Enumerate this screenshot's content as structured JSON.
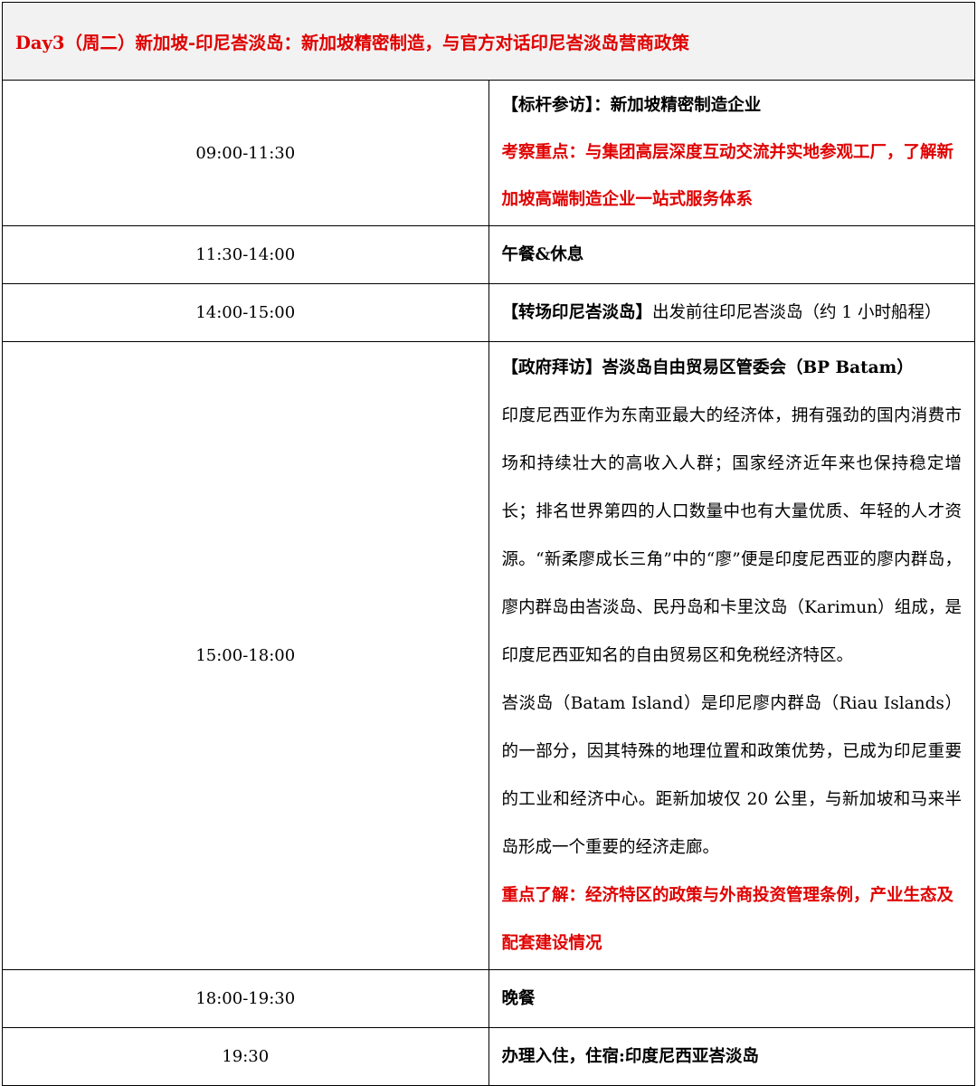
{
  "header": {
    "title": "Day3（周二）新加坡-印尼峇淡岛：新加坡精密制造，与官方对话印尼峇淡岛营商政策"
  },
  "rows": [
    {
      "time": "09:00-11:30",
      "heading_tag": "【标杆参访】",
      "heading_text": "：新加坡精密制造企业",
      "focus": "考察重点：与集团高层深度互动交流并实地参观工厂，了解新加坡高端制造企业一站式服务体系"
    },
    {
      "time": "11:30-14:00",
      "text": "午餐&休息"
    },
    {
      "time": "14:00-15:00",
      "heading_tag": "【转场印尼峇淡岛】",
      "text": "出发前往印尼峇淡岛（约 1 小时船程）"
    },
    {
      "time": "15:00-18:00",
      "heading_tag": "【政府拜访】",
      "heading_text": "峇淡岛自由贸易区管委会（BP Batam）",
      "para1": "印度尼西亚作为东南亚最大的经济体，拥有强劲的国内消费市场和持续壮大的高收入人群；国家经济近年来也保持稳定增长；排名世界第四的人口数量中也有大量优质、年轻的人才资源。“新柔廖成长三角”中的“廖”便是印度尼西亚的廖内群岛，廖内群岛由峇淡岛、民丹岛和卡里汶岛（Karimun）组成，是印度尼西亚知名的自由贸易区和免税经济特区。",
      "para2": "峇淡岛（Batam Island）是印尼廖内群岛（Riau Islands）的一部分，因其特殊的地理位置和政策优势，已成为印尼重要的工业和经济中心。距新加坡仅 20 公里，与新加坡和马来半岛形成一个重要的经济走廊。",
      "focus": "重点了解：经济特区的政策与外商投资管理条例，产业生态及配套建设情况"
    },
    {
      "time": "18:00-19:30",
      "text": "晚餐"
    },
    {
      "time": "19:30",
      "text": "办理入住，住宿:印度尼西亚峇淡岛"
    }
  ]
}
